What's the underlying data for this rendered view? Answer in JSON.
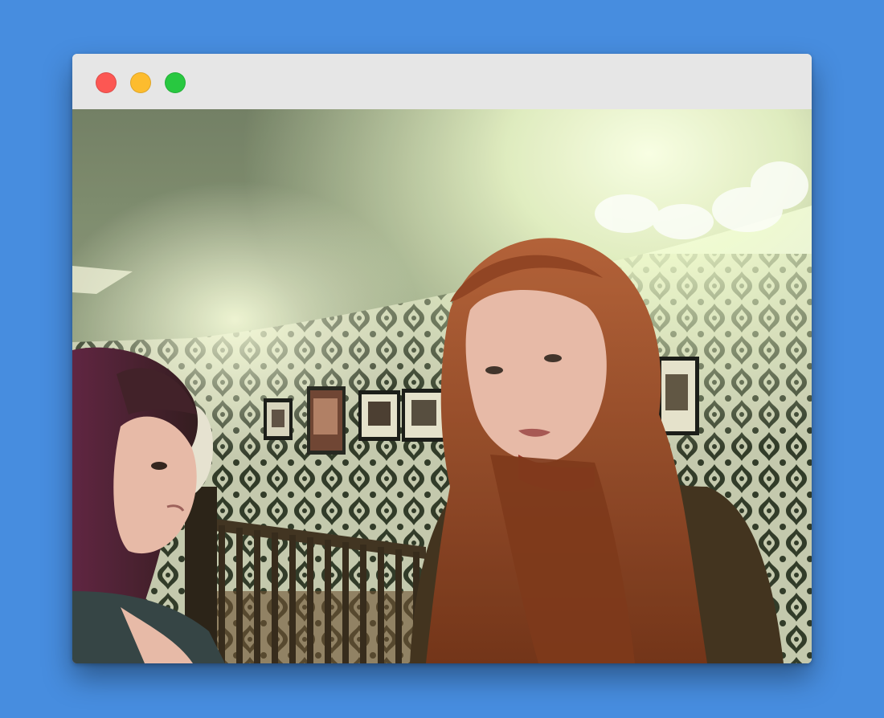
{
  "window": {
    "background_color": "#478ddf",
    "titlebar_color": "#e6e6e6",
    "traffic_lights": [
      {
        "name": "close",
        "color": "#fc5753"
      },
      {
        "name": "minimize",
        "color": "#fdbc2e"
      },
      {
        "name": "maximize",
        "color": "#28c840"
      }
    ]
  },
  "photo": {
    "palette": {
      "ceiling": "#7c8a6e",
      "wallpaper_light": "#e9ead2",
      "wallpaper_dark": "#2d3328",
      "railing": "#3a2a1b",
      "hair_red": "#8e3b1d",
      "hair_dark": "#3a1622",
      "coat": "#3b2918",
      "skin": "#e9b7a8"
    }
  }
}
